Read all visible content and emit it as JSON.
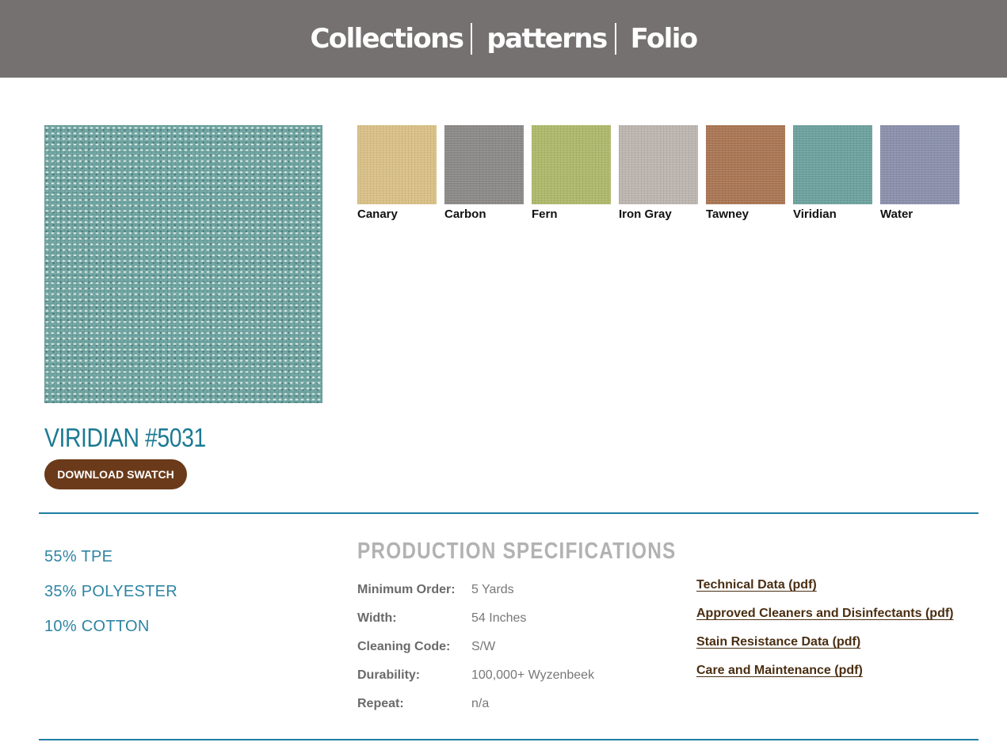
{
  "nav": {
    "items": [
      {
        "label": "Collections"
      },
      {
        "label": "patterns"
      },
      {
        "label": "Folio"
      }
    ]
  },
  "product": {
    "title": "VIRIDIAN #5031",
    "download_label": "DOWNLOAD SWATCH",
    "main_swatch_color": "#6ca3a0"
  },
  "colorways": [
    {
      "name": "Canary",
      "color": "#d8bf85"
    },
    {
      "name": "Carbon",
      "color": "#8b8987"
    },
    {
      "name": "Fern",
      "color": "#adb86a"
    },
    {
      "name": "Iron Gray",
      "color": "#bcb4ae"
    },
    {
      "name": "Tawney",
      "color": "#a97553"
    },
    {
      "name": "Viridian",
      "color": "#6ca19d"
    },
    {
      "name": "Water",
      "color": "#8a8fab"
    }
  ],
  "content": [
    "55% TPE",
    "35% POLYESTER",
    "10% COTTON"
  ],
  "specs": {
    "title": "PRODUCTION SPECIFICATIONS",
    "rows": [
      {
        "label": "Minimum Order:",
        "value": "5 Yards"
      },
      {
        "label": "Width:",
        "value": "54 Inches"
      },
      {
        "label": "Cleaning Code:",
        "value": "S/W"
      },
      {
        "label": "Durability:",
        "value": "100,000+ Wyzenbeek"
      },
      {
        "label": "Repeat:",
        "value": "n/a"
      }
    ]
  },
  "documents": [
    {
      "label": "Technical Data (pdf)"
    },
    {
      "label": "Approved Cleaners and Disinfectants (pdf)"
    },
    {
      "label": "Stain Resistance Data (pdf)"
    },
    {
      "label": "Care and Maintenance (pdf)"
    }
  ],
  "colors": {
    "header_bg": "#767171",
    "accent_blue": "#1b7a93",
    "button_brown": "#6a3a1a",
    "link_brown": "#4a2e12"
  }
}
